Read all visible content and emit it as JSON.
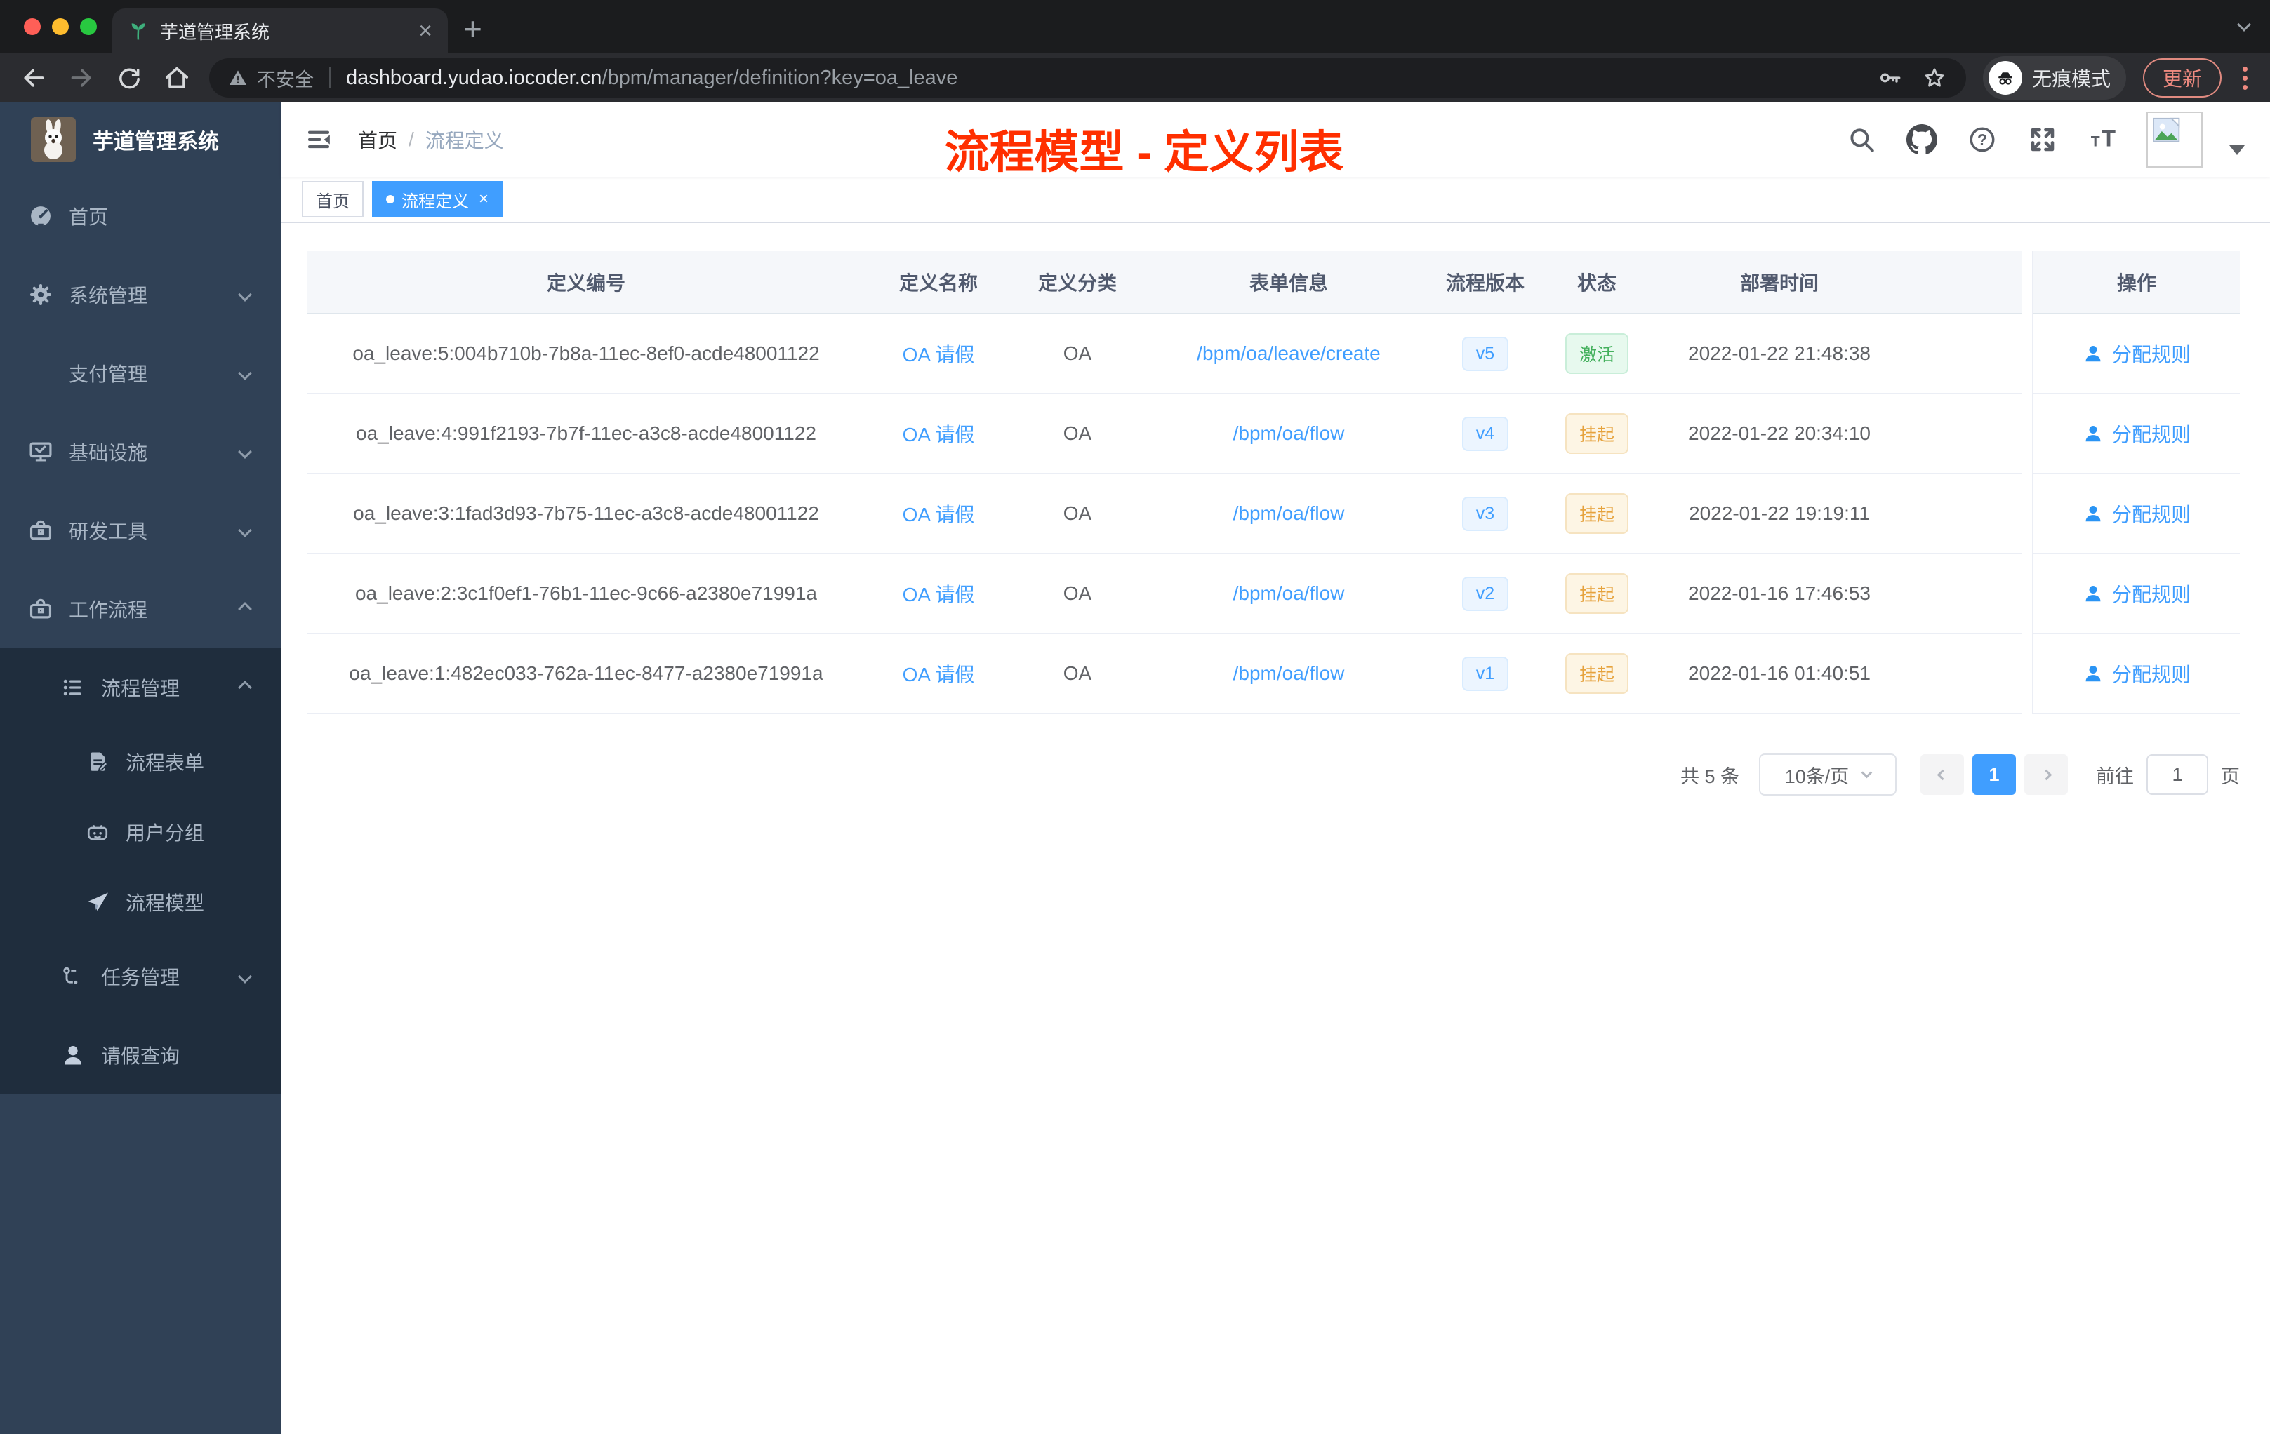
{
  "colors": {
    "accent": "#409eff",
    "success": "#43b05c",
    "warning": "#e6a23c",
    "annotation": "#ff2f00",
    "sidebar_bg": "#304156",
    "submenu_bg": "#1f2d3d"
  },
  "browser": {
    "tab": {
      "title": "芋道管理系统"
    },
    "toolbar": {
      "security_label": "不安全",
      "url_domain": "dashboard.yudao.iocoder.cn",
      "url_path": "/bpm/manager/definition?key=oa_leave",
      "incognito_label": "无痕模式",
      "update_label": "更新"
    }
  },
  "sidebar": {
    "logo_title": "芋道管理系统",
    "items": [
      {
        "label": "首页"
      },
      {
        "label": "系统管理"
      },
      {
        "label": "支付管理"
      },
      {
        "label": "基础设施"
      },
      {
        "label": "研发工具"
      },
      {
        "label": "工作流程"
      },
      {
        "label": "流程管理"
      },
      {
        "label": "流程表单"
      },
      {
        "label": "用户分组"
      },
      {
        "label": "流程模型"
      },
      {
        "label": "任务管理"
      },
      {
        "label": "请假查询"
      }
    ]
  },
  "navbar": {
    "breadcrumb_home": "首页",
    "breadcrumb_current": "流程定义"
  },
  "annotation": "流程模型 - 定义列表",
  "tags": {
    "home": "首页",
    "active": "流程定义"
  },
  "table": {
    "columns": [
      "定义编号",
      "定义名称",
      "定义分类",
      "表单信息",
      "流程版本",
      "状态",
      "部署时间",
      "操作"
    ],
    "rows": [
      {
        "id": "oa_leave:5:004b710b-7b8a-11ec-8ef0-acde48001122",
        "name": "OA 请假",
        "category": "OA",
        "form": "/bpm/oa/leave/create",
        "version": "v5",
        "status": "激活",
        "deployed_at": "2022-01-22 21:48:38",
        "action": "分配规则"
      },
      {
        "id": "oa_leave:4:991f2193-7b7f-11ec-a3c8-acde48001122",
        "name": "OA 请假",
        "category": "OA",
        "form": "/bpm/oa/flow",
        "version": "v4",
        "status": "挂起",
        "deployed_at": "2022-01-22 20:34:10",
        "action": "分配规则"
      },
      {
        "id": "oa_leave:3:1fad3d93-7b75-11ec-a3c8-acde48001122",
        "name": "OA 请假",
        "category": "OA",
        "form": "/bpm/oa/flow",
        "version": "v3",
        "status": "挂起",
        "deployed_at": "2022-01-22 19:19:11",
        "action": "分配规则"
      },
      {
        "id": "oa_leave:2:3c1f0ef1-76b1-11ec-9c66-a2380e71991a",
        "name": "OA 请假",
        "category": "OA",
        "form": "/bpm/oa/flow",
        "version": "v2",
        "status": "挂起",
        "deployed_at": "2022-01-16 17:46:53",
        "action": "分配规则"
      },
      {
        "id": "oa_leave:1:482ec033-762a-11ec-8477-a2380e71991a",
        "name": "OA 请假",
        "category": "OA",
        "form": "/bpm/oa/flow",
        "version": "v1",
        "status": "挂起",
        "deployed_at": "2022-01-16 01:40:51",
        "action": "分配规则"
      }
    ]
  },
  "pagination": {
    "total": "共 5 条",
    "page_size": "10条/页",
    "page": "1",
    "jump_prefix": "前往",
    "jump_value": "1",
    "jump_suffix": "页"
  },
  "glyphs": {
    "close_tab": "×",
    "new_tab": "+",
    "tag_close": "×",
    "breadcrumb_separator": "/",
    "help": "?",
    "font_size_small": "T",
    "font_size_large": "T"
  }
}
